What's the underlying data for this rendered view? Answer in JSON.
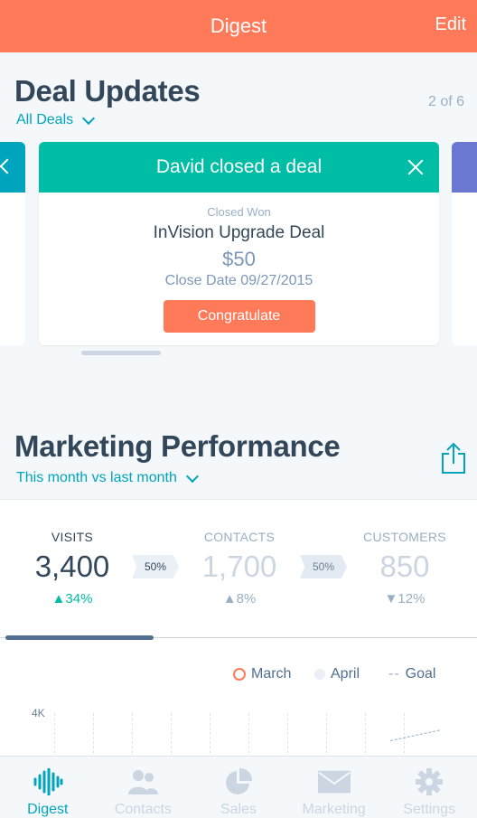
{
  "header": {
    "title": "Digest",
    "edit_label": "Edit"
  },
  "deals": {
    "title": "Deal Updates",
    "filter": "All Deals",
    "counter": "2 of 6",
    "card": {
      "headline": "David closed a deal",
      "stage": "Closed Won",
      "name": "InVision Upgrade Deal",
      "amount": "$50",
      "close_date": "Close Date 09/27/2015",
      "button": "Congratulate"
    }
  },
  "marketing": {
    "title": "Marketing Performance",
    "filter": "This month vs last month",
    "metrics": [
      {
        "label": "VISITS",
        "value": "3,400",
        "delta": "34%",
        "direction": "up"
      },
      {
        "label": "CONTACTS",
        "value": "1,700",
        "delta": "8%",
        "direction": "up"
      },
      {
        "label": "CUSTOMERS",
        "value": "850",
        "delta": "12%",
        "direction": "down"
      }
    ],
    "conversions": [
      "50%",
      "50%"
    ],
    "legend": {
      "march": "March",
      "april": "April",
      "goal": "Goal"
    },
    "y_axis_label": "4K"
  },
  "tabs": [
    {
      "label": "Digest",
      "icon": "waveform-icon"
    },
    {
      "label": "Contacts",
      "icon": "people-icon"
    },
    {
      "label": "Sales",
      "icon": "pie-chart-icon"
    },
    {
      "label": "Marketing",
      "icon": "envelope-icon"
    },
    {
      "label": "Settings",
      "icon": "gear-icon"
    }
  ],
  "colors": {
    "header": "#ff7a59",
    "accent": "#00a4bd",
    "card_band": "#00bda5",
    "positive": "#00bda5",
    "neutral": "#99afc4"
  }
}
